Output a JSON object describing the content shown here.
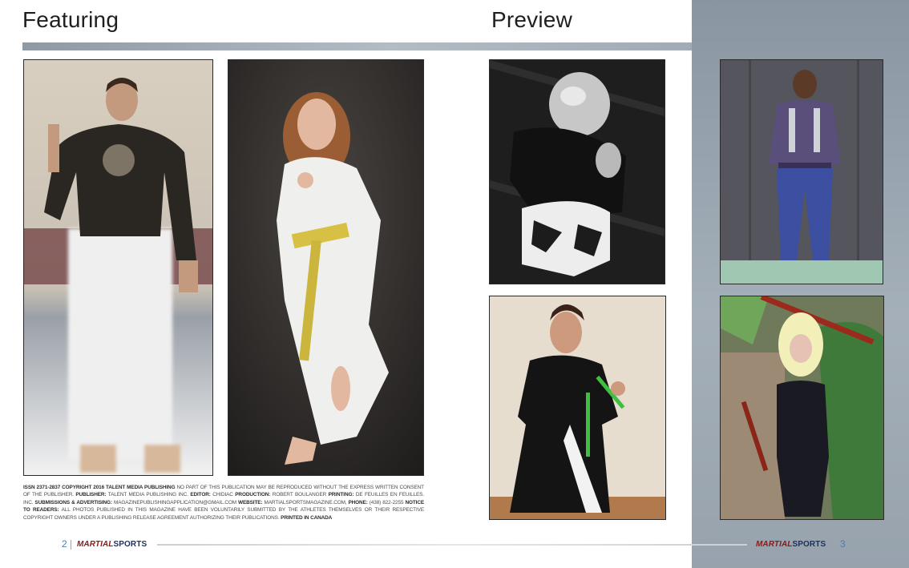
{
  "left_page": {
    "heading": "Featuring",
    "page_number": "2",
    "brand_part1": "MARTIAL",
    "brand_part2": "SPORTS"
  },
  "right_page": {
    "heading": "Preview",
    "page_number": "3",
    "brand_part1": "MARTIAL",
    "brand_part2": "SPORTS"
  },
  "credits": {
    "issn": "ISSN 2371-2837 COPYRIGHT 2016 TALENT MEDIA PUBLISHING",
    "copyright_text": " NO PART OF THIS PUBLICATION MAY BE REPRODUCED WITHOUT THE EXPRESS WRITTEN CONSENT OF THE PUBLISHER. ",
    "publisher_label": "PUBLISHER:",
    "publisher_value": " TALENT MEDIA PUBLISHING INC. ",
    "editor_label": "EDITOR:",
    "editor_value": " CHIDIAC ",
    "production_label": "PRODUCTION:",
    "production_value": " ROBERT BOULANGER ",
    "printing_label": "PRINTING:",
    "printing_value": " DE FEUILLES EN FEUILLES. INC. ",
    "submissions_label": "SUBMISSIONS & ADVERTISING:",
    "submissions_value": " MAGAZINEPUBLISHINGAPPLICATION@GMAIL.COM ",
    "website_label": "WEBSITE:",
    "website_value": " MARTIALSPORTSMAGAZINE.COM, ",
    "phone_label": "PHONE:",
    "phone_value": " (438) 822-2255 ",
    "notice_label": "NOTICE TO READERS:",
    "notice_value": " ALL PHOTOS PUBLISHED IN THIS MAGAZINE HAVE BEEN VOLUNTARILY SUBMITTED BY THE ATHLETES THEMSELVES OR THEIR RESPECTIVE COPYRIGHT OWNERS UNDER A PUBLISHING RELEASE AGREEMENT AUTHORIZING THEIR PUBLICATIONS. ",
    "printed": "PRINTED IN CANADA"
  },
  "photos": [
    {
      "id": "p1",
      "icon": "athlete-pointing-photo"
    },
    {
      "id": "p2",
      "icon": "girl-karate-kick-photo"
    },
    {
      "id": "p3",
      "icon": "bald-man-kneeling-photo"
    },
    {
      "id": "p4",
      "icon": "woman-nunchaku-photo"
    },
    {
      "id": "p5",
      "icon": "gi-standing-photo"
    },
    {
      "id": "p6",
      "icon": "blonde-bo-staff-photo"
    }
  ],
  "colors": {
    "right_panel": "#97a2ad",
    "page_number": "#4a7fb2",
    "brand_red": "#8a1a1a",
    "brand_navy": "#1d2f5b"
  }
}
